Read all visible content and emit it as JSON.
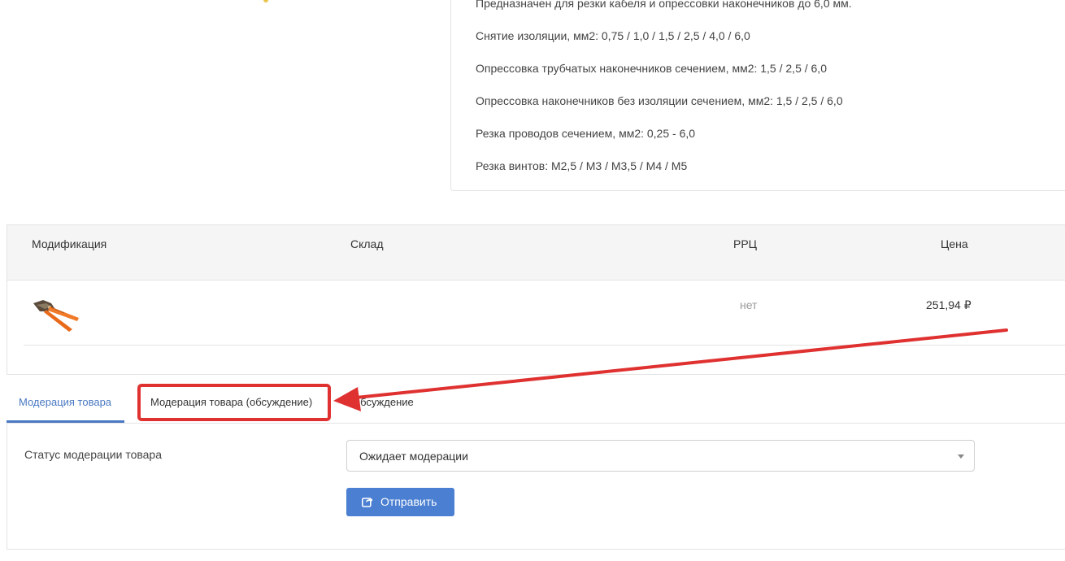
{
  "description": {
    "lines": [
      "Предназначен для резки кабеля и опрессовки наконечников до 6,0 мм.",
      "Снятие изоляции, мм2: 0,75 / 1,0 / 1,5 / 2,5 / 4,0 / 6,0",
      "Опрессовка трубчатых наконечников сечением, мм2: 1,5 / 2,5 / 6,0",
      "Опрессовка наконечников без изоляции сечением, мм2: 1,5 / 2,5 / 6,0",
      "Резка проводов сечением, мм2: 0,25 - 6,0",
      "Резка винтов: М2,5 / М3 / М3,5 / М4 / М5"
    ]
  },
  "table": {
    "headers": {
      "modification": "Модификация",
      "warehouse": "Склад",
      "rrp": "РРЦ",
      "price": "Цена"
    },
    "rows": [
      {
        "image": "crimping-tool-image",
        "warehouse": "",
        "rrp": "нет",
        "price": "251,94 ₽"
      }
    ]
  },
  "tabs": [
    {
      "label": "Модерация товара",
      "active": true
    },
    {
      "label": "Модерация товара (обсуждение)",
      "active": false
    },
    {
      "label": "Обсуждение",
      "active": false
    }
  ],
  "moderation": {
    "status_label": "Статус модерации товара",
    "status_value": "Ожидает модерации",
    "submit_label": "Отправить",
    "submit_icon": "share-icon"
  },
  "colors": {
    "accent": "#4a78c2",
    "button": "#4a7fd2",
    "annotation": "#e03131"
  }
}
